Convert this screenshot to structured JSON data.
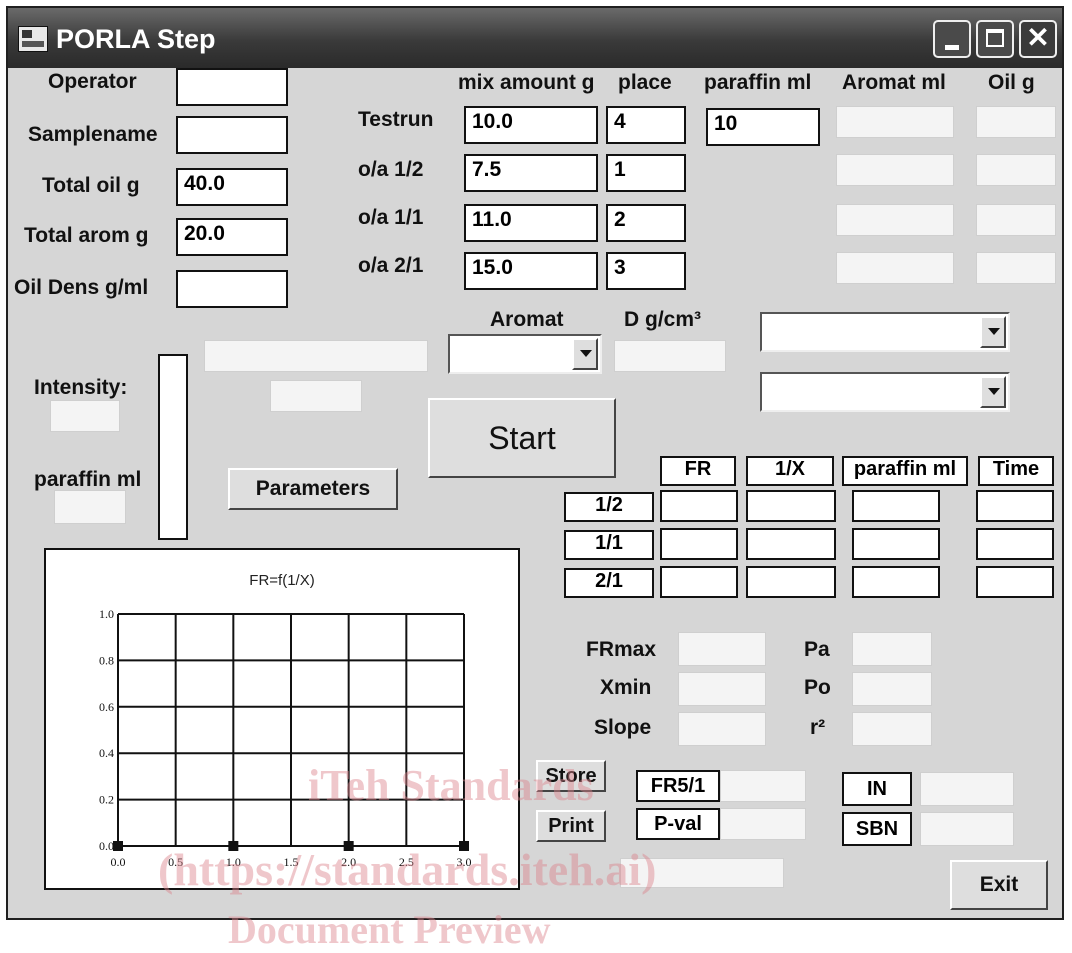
{
  "window": {
    "title": "PORLA Step",
    "controls": {
      "minimize": "minimize",
      "maximize": "maximize",
      "close": "✕"
    }
  },
  "left_form": {
    "operator_label": "Operator",
    "operator_value": "",
    "samplename_label": "Samplename",
    "samplename_value": "",
    "total_oil_label": "Total oil g",
    "total_oil_value": "40.0",
    "total_arom_label": "Total arom g",
    "total_arom_value": "20.0",
    "oil_dens_label": "Oil Dens g/ml",
    "oil_dens_value": ""
  },
  "mix_table": {
    "headers": {
      "mix_amount": "mix amount g",
      "place": "place",
      "paraffin": "paraffin ml",
      "aromat": "Aromat ml",
      "oil": "Oil g"
    },
    "rows": [
      {
        "label": "Testrun",
        "mix": "10.0",
        "place": "4",
        "paraffin": "10"
      },
      {
        "label": "o/a 1/2",
        "mix": "7.5",
        "place": "1"
      },
      {
        "label": "o/a 1/1",
        "mix": "11.0",
        "place": "2"
      },
      {
        "label": "o/a 2/1",
        "mix": "15.0",
        "place": "3"
      }
    ]
  },
  "aromat_section": {
    "aromat_label": "Aromat",
    "density_label": "D g/cm³"
  },
  "intensity_label": "Intensity:",
  "paraffin_ml_label": "paraffin ml",
  "buttons": {
    "parameters": "Parameters",
    "start": "Start",
    "store": "Store",
    "print": "Print",
    "exit": "Exit"
  },
  "results_table": {
    "headers": [
      "FR",
      "1/X",
      "paraffin ml",
      "Time"
    ],
    "rows": [
      "1/2",
      "1/1",
      "2/1"
    ]
  },
  "stats": {
    "frmax_label": "FRmax",
    "xmin_label": "Xmin",
    "slope_label": "Slope",
    "pa_label": "Pa",
    "po_label": "Po",
    "r2_label": "r²"
  },
  "bottom": {
    "fr51_label": "FR5/1",
    "pval_label": "P-val",
    "in_label": "IN",
    "sbn_label": "SBN"
  },
  "chart_data": {
    "type": "scatter",
    "title": "FR=f(1/X)",
    "xlabel": "",
    "ylabel": "",
    "xlim": [
      0,
      3.0
    ],
    "ylim": [
      0,
      1.0
    ],
    "x_ticks": [
      "0.0",
      "0.5",
      "1.0",
      "1.5",
      "2.0",
      "2.5",
      "3.0"
    ],
    "y_ticks": [
      "0.0",
      "0.2",
      "0.4",
      "0.6",
      "0.8",
      "1.0"
    ],
    "grid": true,
    "series": [
      {
        "x": [
          0.0,
          1.0,
          2.0,
          3.0
        ],
        "y": [
          0.0,
          0.0,
          0.0,
          0.0
        ]
      }
    ]
  },
  "watermark": {
    "line1": "iTeh Standards",
    "line2": "(https://standards.iteh.ai)",
    "line3": "Document Preview"
  }
}
